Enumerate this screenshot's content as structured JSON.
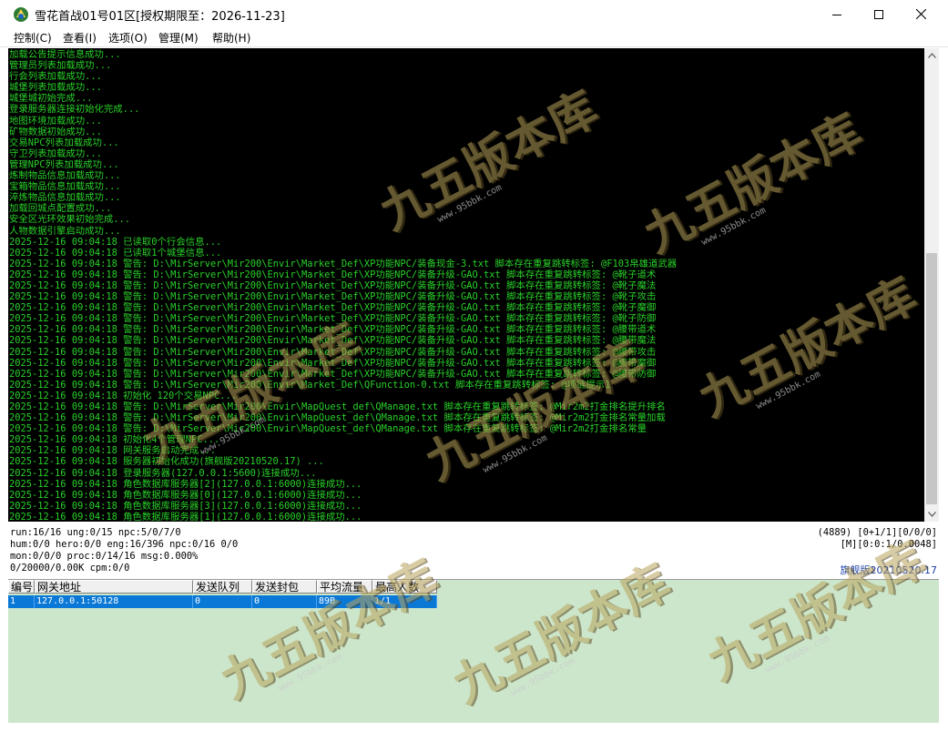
{
  "window": {
    "title": "雪花首战01号01区[授权期限至：2026-11-23]",
    "controls": {
      "minimize": "minimize-icon",
      "maximize": "maximize-icon",
      "close": "close-icon"
    }
  },
  "menu": [
    {
      "label": "控制(C)"
    },
    {
      "label": "查看(I)"
    },
    {
      "label": "选项(O)"
    },
    {
      "label": "管理(M)"
    },
    {
      "label": "帮助(H)"
    }
  ],
  "console": {
    "text_color": "#29d129",
    "background": "#000000",
    "lines": [
      "加载公告提示信息成功...",
      "管理员列表加载成功...",
      "行会列表加载成功...",
      "城堡列表加载成功...",
      "城堡城初始完成...",
      "登录服务器连接初始化完成...",
      "地图环境加载成功...",
      "矿物数据初始成功...",
      "交易NPC列表加载成功...",
      "守卫列表加载成功...",
      "管理NPC列表加载成功...",
      "炼制物品信息加载成功...",
      "宝箱物品信息加载成功...",
      "淬炼物品信息加载成功...",
      "加载回城点配置成功...",
      "安全区光环效果初始完成...",
      "人物数据引擎启动成功...",
      "2025-12-16 09:04:18 已读取0个行会信息...",
      "2025-12-16 09:04:18 已读取1个城堡信息...",
      "2025-12-16 09:04:18 警告: D:\\MirServer\\Mir200\\Envir\\Market_Def\\XP功能NPC/装备现金-3.txt 脚本存在重复跳转标签: @F103帛雄道武器",
      "2025-12-16 09:04:18 警告: D:\\MirServer\\Mir200\\Envir\\Market_Def\\XP功能NPC/装备升级-GAO.txt 脚本存在重复跳转标签: @靴子道术",
      "2025-12-16 09:04:18 警告: D:\\MirServer\\Mir200\\Envir\\Market_Def\\XP功能NPC/装备升级-GAO.txt 脚本存在重复跳转标签: @靴子魔法",
      "2025-12-16 09:04:18 警告: D:\\MirServer\\Mir200\\Envir\\Market_Def\\XP功能NPC/装备升级-GAO.txt 脚本存在重复跳转标签: @靴子攻击",
      "2025-12-16 09:04:18 警告: D:\\MirServer\\Mir200\\Envir\\Market_Def\\XP功能NPC/装备升级-GAO.txt 脚本存在重复跳转标签: @靴子魔御",
      "2025-12-16 09:04:18 警告: D:\\MirServer\\Mir200\\Envir\\Market_Def\\XP功能NPC/装备升级-GAO.txt 脚本存在重复跳转标签: @靴子防御",
      "2025-12-16 09:04:18 警告: D:\\MirServer\\Mir200\\Envir\\Market_Def\\XP功能NPC/装备升级-GAO.txt 脚本存在重复跳转标签: @腰带道术",
      "2025-12-16 09:04:18 警告: D:\\MirServer\\Mir200\\Envir\\Market_Def\\XP功能NPC/装备升级-GAO.txt 脚本存在重复跳转标签: @腰带魔法",
      "2025-12-16 09:04:18 警告: D:\\MirServer\\Mir200\\Envir\\Market_Def\\XP功能NPC/装备升级-GAO.txt 脚本存在重复跳转标签: @腰带攻击",
      "2025-12-16 09:04:18 警告: D:\\MirServer\\Mir200\\Envir\\Market_Def\\XP功能NPC/装备升级-GAO.txt 脚本存在重复跳转标签: @腰带魔御",
      "2025-12-16 09:04:18 警告: D:\\MirServer\\Mir200\\Envir\\Market_Def\\XP功能NPC/装备升级-GAO.txt 脚本存在重复跳转标签: @腰带防御",
      "2025-12-16 09:04:18 警告: D:\\MirServer\\Mir200\\Envir\\Market_Def\\QFunction-0.txt 脚本存在重复跳转标签: @项链提示1",
      "2025-12-16 09:04:18 初始化 120个交易NPC...",
      "2025-12-16 09:04:18 警告: D:\\MirServer\\Mir200\\Envir\\MapQuest_def\\QManage.txt 脚本存在重复跳转标签: @Mir2m2打金排名提升排名",
      "2025-12-16 09:04:18 警告: D:\\MirServer\\Mir200\\Envir\\MapQuest_def\\QManage.txt 脚本存在重复跳转标签: @Mir2m2打金排名常量加载",
      "2025-12-16 09:04:18 警告: D:\\MirServer\\Mir200\\Envir\\MapQuest_def\\QManage.txt 脚本存在重复跳转标签: @Mir2m2打金排名常量",
      "2025-12-16 09:04:18 初始化4个管理NPC...",
      "2025-12-16 09:04:18 网关服务启动完成...",
      "2025-12-16 09:04:18 服务器初始化成功(旗舰版20210520.17) ...",
      "2025-12-16 09:04:18 登录服务器(127.0.0.1:5600)连接成功...",
      "2025-12-16 09:04:18 角色数据库服务器[2](127.0.0.1:6000)连接成功...",
      "2025-12-16 09:04:18 角色数据库服务器[0](127.0.0.1:6000)连接成功...",
      "2025-12-16 09:04:18 角色数据库服务器[3](127.0.0.1:6000)连接成功...",
      "2025-12-16 09:04:18 角色数据库服务器[1](127.0.0.1:6000)连接成功..."
    ]
  },
  "status": {
    "line1": "run:16/16 ung:0/15 npc:5/0/7/0",
    "line2": "hum:0/0 hero:0/0 eng:16/396 npc:0/16 0/0",
    "line3": "mon:0/0/0 proc:0/14/16 msg:0.000%",
    "line4": "0/20000/0.00K cpm:0/0",
    "right1": "(4889) [0+1/1][0/0/0]",
    "right2": "[M][0:0:1/0.0048]",
    "version": "旗舰版20210520.17",
    "version_color": "#1a3fa8"
  },
  "gateway_table": {
    "columns": [
      "编号",
      "网关地址",
      "发送队列",
      "发送封包",
      "平均流量",
      "最高人数"
    ],
    "rows": [
      [
        "1",
        "127.0.0.1:50128",
        "0",
        "0",
        "89B",
        "1/1"
      ]
    ],
    "selected_color": "#0a78d7",
    "background": "#cce6cc"
  },
  "watermark": {
    "logo_text": "九五版本库",
    "site": "www.95bbk.com"
  }
}
